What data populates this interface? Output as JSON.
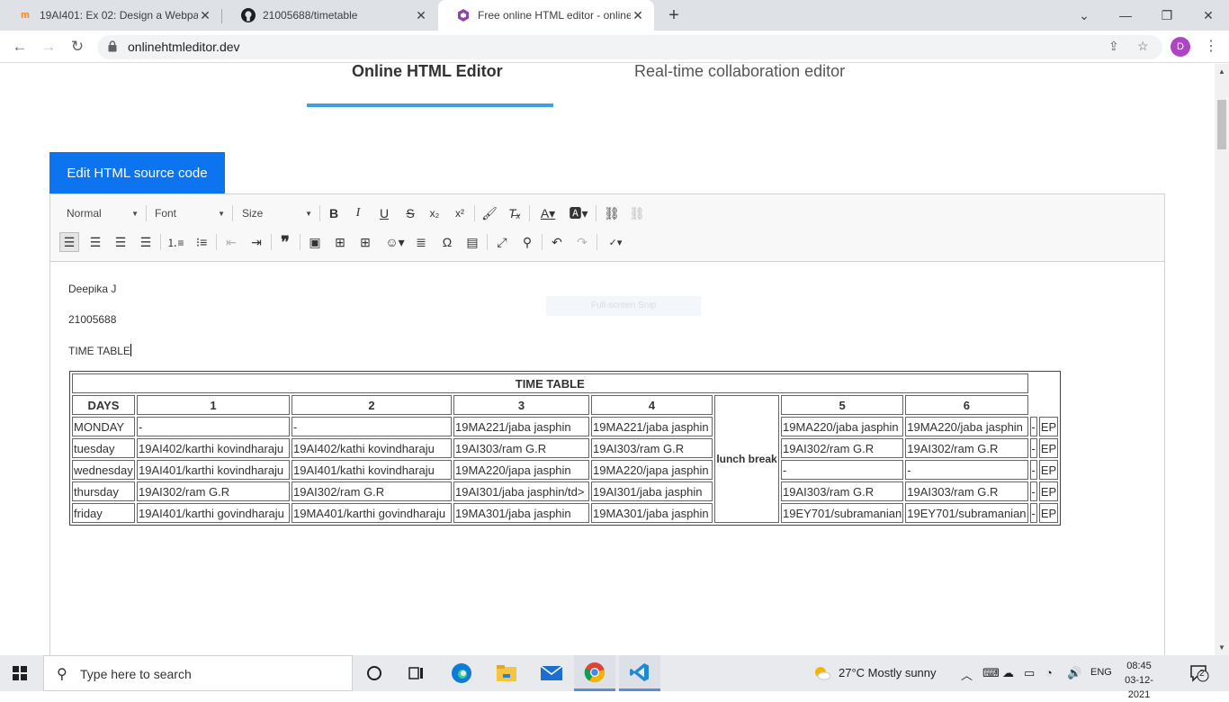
{
  "browser": {
    "tabs": [
      {
        "title": "19AI401: Ex 02: Design a Webpag",
        "icon": "moodle-icon"
      },
      {
        "title": "21005688/timetable",
        "icon": "github-icon"
      },
      {
        "title": "Free online HTML editor - online",
        "icon": "editor-icon",
        "active": true
      }
    ],
    "url": "onlinehtmleditor.dev",
    "profile_initial": "D"
  },
  "site": {
    "nav": [
      "Online HTML Editor",
      "Real-time collaboration editor"
    ],
    "edit_button": "Edit HTML source code"
  },
  "editor": {
    "format_combo": "Normal",
    "font_combo": "Font",
    "size_combo": "Size",
    "lines": [
      "Deepika J",
      "21005688",
      "TIME TABLE"
    ],
    "snip_overlay": "Full-screen Snip"
  },
  "timetable": {
    "title": "TIME TABLE",
    "headers": [
      "DAYS",
      "1",
      "2",
      "3",
      "4",
      "5",
      "6"
    ],
    "lunch": "lunch break",
    "rows": [
      {
        "day": "MONDAY",
        "p1": "-",
        "p2": "-",
        "p3": "19MA221/jaba jasphin",
        "p4": "19MA221/jaba jasphin",
        "p5": "19MA220/jaba jasphin",
        "p6": "19MA220/jaba jasphin",
        "x": "-",
        "y": "EP"
      },
      {
        "day": "tuesday",
        "p1": "19AI402/karthi kovindharaju",
        "p2": "19AI402/kathi kovindharaju",
        "p3": "19AI303/ram G.R",
        "p4": "19AI303/ram G.R",
        "p5": "19AI302/ram G.R",
        "p6": "19AI302/ram G.R",
        "x": "-",
        "y": "EP"
      },
      {
        "day": "wednesday",
        "p1": "19AI401/karthi kovindharaju",
        "p2": "19AI401/kathi kovindharaju",
        "p3": "19MA220/japa jasphin",
        "p4": "19MA220/japa jasphin",
        "p5": "-",
        "p6": "-",
        "x": "-",
        "y": "EP"
      },
      {
        "day": "thursday",
        "p1": "19AI302/ram G.R",
        "p2": "19AI302/ram G.R",
        "p3": "19AI301/jaba jasphin/td>",
        "p4": "19AI301/jaba jasphin",
        "p5": "19AI303/ram G.R",
        "p6": "19AI303/ram G.R",
        "x": "-",
        "y": "EP"
      },
      {
        "day": "friday",
        "p1": "19AI401/karthi govindharaju",
        "p2": "19MA401/karthi govindharaju",
        "p3": "19MA301/jaba jasphin",
        "p4": "19MA301/jaba jasphin",
        "p5": "19EY701/subramanian",
        "p6": "19EY701/subramanian",
        "x": "-",
        "y": "EP"
      }
    ]
  },
  "taskbar": {
    "search_placeholder": "Type here to search",
    "weather": "27°C  Mostly sunny",
    "language": "ENG",
    "time": "08:45",
    "date": "03-12-2021",
    "notifications": "2"
  }
}
